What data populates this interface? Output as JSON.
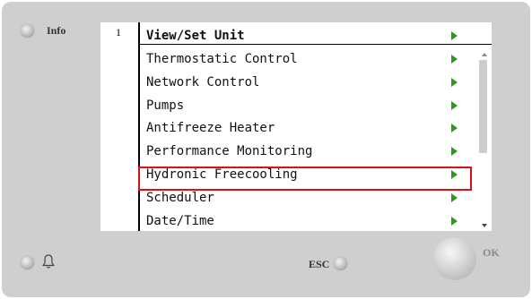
{
  "panel": {
    "info_label": "Info",
    "esc_label": "ESC",
    "ok_label": "OK"
  },
  "screen": {
    "page_number": "1",
    "header": {
      "label": "View/Set Unit"
    },
    "items": [
      {
        "label": "Thermostatic Control"
      },
      {
        "label": "Network Control"
      },
      {
        "label": "Pumps"
      },
      {
        "label": "Antifreeze Heater"
      },
      {
        "label": "Performance Monitoring"
      },
      {
        "label": "Hydronic Freecooling",
        "highlighted": true
      },
      {
        "label": "Scheduler"
      },
      {
        "label": "Date/Time"
      }
    ]
  },
  "icons": {
    "submenu_arrow": "green-right-triangle-icon",
    "alarm": "bell-icon"
  },
  "colors": {
    "arrow": "#2c9a1f",
    "highlight": "#e01010",
    "panel": "#cfcfcf"
  }
}
